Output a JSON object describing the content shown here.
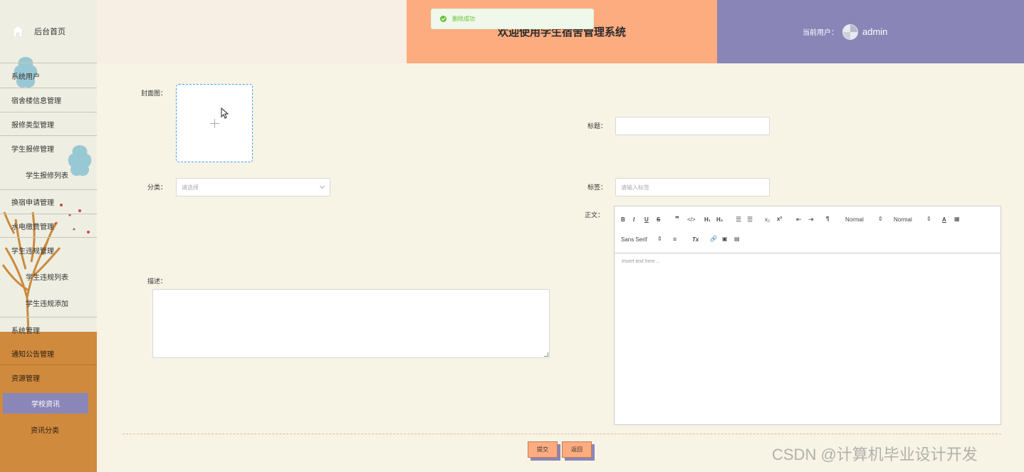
{
  "sidebar": {
    "home_label": "后台首页",
    "items": [
      {
        "label": "系统用户"
      },
      {
        "label": "宿舍楼信息管理"
      },
      {
        "label": "报修类型管理"
      },
      {
        "label": "学生报修管理"
      },
      {
        "label": "学生报修列表"
      },
      {
        "label": "换宿申请管理"
      },
      {
        "label": "水电缴费管理"
      },
      {
        "label": "学生违规管理"
      },
      {
        "label": "学生违规列表"
      },
      {
        "label": "学生违规添加"
      },
      {
        "label": "系统管理"
      },
      {
        "label": "通知公告管理"
      },
      {
        "label": "资源管理"
      },
      {
        "label": "学校资讯"
      },
      {
        "label": "资讯分类"
      }
    ]
  },
  "header": {
    "title": "欢迎使用学生宿舍管理系统",
    "current_user_label": "当前用户：",
    "username": "admin"
  },
  "toast": {
    "message": "删除成功"
  },
  "form": {
    "cover_label": "封面图：",
    "title_label": "标题：",
    "title_value": "",
    "category_label": "分类：",
    "category_placeholder": "请选择",
    "tags_label": "标签：",
    "tags_placeholder": "请输入标签",
    "content_label": "正文：",
    "description_label": "描述：",
    "editor": {
      "font_size_1": "Normal",
      "font_size_2": "Normal",
      "font_family": "Sans Serif",
      "placeholder": "Insert text here ..."
    },
    "submit_label": "提交",
    "back_label": "返回"
  },
  "watermark": "CSDN @计算机毕业设计开发",
  "colors": {
    "sidebar_bg": "#efeee2",
    "sidebar_bottom": "#d08a3e",
    "header_peach": "#fdac80",
    "header_purple": "#8a85b7",
    "page_bg": "#f7f4e6",
    "success": "#67c23a"
  }
}
